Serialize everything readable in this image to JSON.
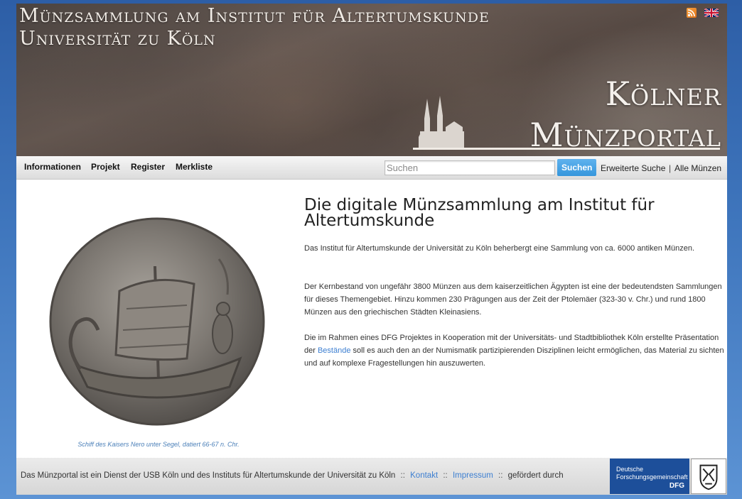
{
  "banner": {
    "title_line1": "Münzsammlung am Institut für Altertumskunde",
    "title_line2": "Universität zu Köln",
    "logo_line1": "Kölner",
    "logo_line2": "Münzportal",
    "icons": [
      "rss-icon",
      "flag-en-icon",
      "cathedral-icon"
    ]
  },
  "nav": {
    "items": [
      {
        "label": "Informationen"
      },
      {
        "label": "Projekt"
      },
      {
        "label": "Register"
      },
      {
        "label": "Merkliste"
      }
    ],
    "search": {
      "placeholder": "Suchen",
      "button": "Suchen"
    },
    "advanced_search": "Erweiterte Suche",
    "separator": "|",
    "all_coins": "Alle Münzen"
  },
  "main": {
    "image_caption": "Schiff des Kaisers Nero unter Segel, datiert 66-67 n. Chr.",
    "heading": "Die digitale Münzsammlung am Institut für Altertumskunde",
    "paragraph1": "Das Institut für Altertumskunde der Universität zu Köln beherbergt eine Sammlung von ca. 6000 antiken Münzen.",
    "paragraph2": "Der Kernbestand von ungefähr 3800 Münzen aus dem kaiserzeitlichen Ägypten ist eine der bedeutendsten Sammlungen für dieses Themengebiet. Hinzu kommen 230 Prägungen aus der Zeit der Ptolemäer (323-30 v. Chr.) und rund 1800 Münzen aus den griechischen Städten Kleinasiens.",
    "paragraph3_before": "Die im Rahmen eines DFG Projektes in Kooperation mit der Universitäts- und Stadtbibliothek Köln erstellte Präsentation der ",
    "paragraph3_link": "Bestände",
    "paragraph3_after": " soll es auch den an der Numismatik partizipierenden Disziplinen leicht ermöglichen, das Material zu sichten und auf komplexe Fragestellungen hin auszuwerten."
  },
  "footer": {
    "text": "Das Münzportal ist ein Dienst der USB Köln und des Instituts für Altertumskunde der Universität zu Köln",
    "separator": "::",
    "contact": "Kontakt",
    "imprint": "Impressum",
    "funded_by": "gefördert durch",
    "dfg_line1": "Deutsche",
    "dfg_line2": "Forschungsgemeinschaft",
    "dfg_abbr": "DFG"
  },
  "colors": {
    "page_background": "#3f76bd",
    "link": "#3d7fd1",
    "search_button": "#3596dc",
    "caption": "#4a7fb8",
    "dfg_blue": "#1d4f9a"
  }
}
